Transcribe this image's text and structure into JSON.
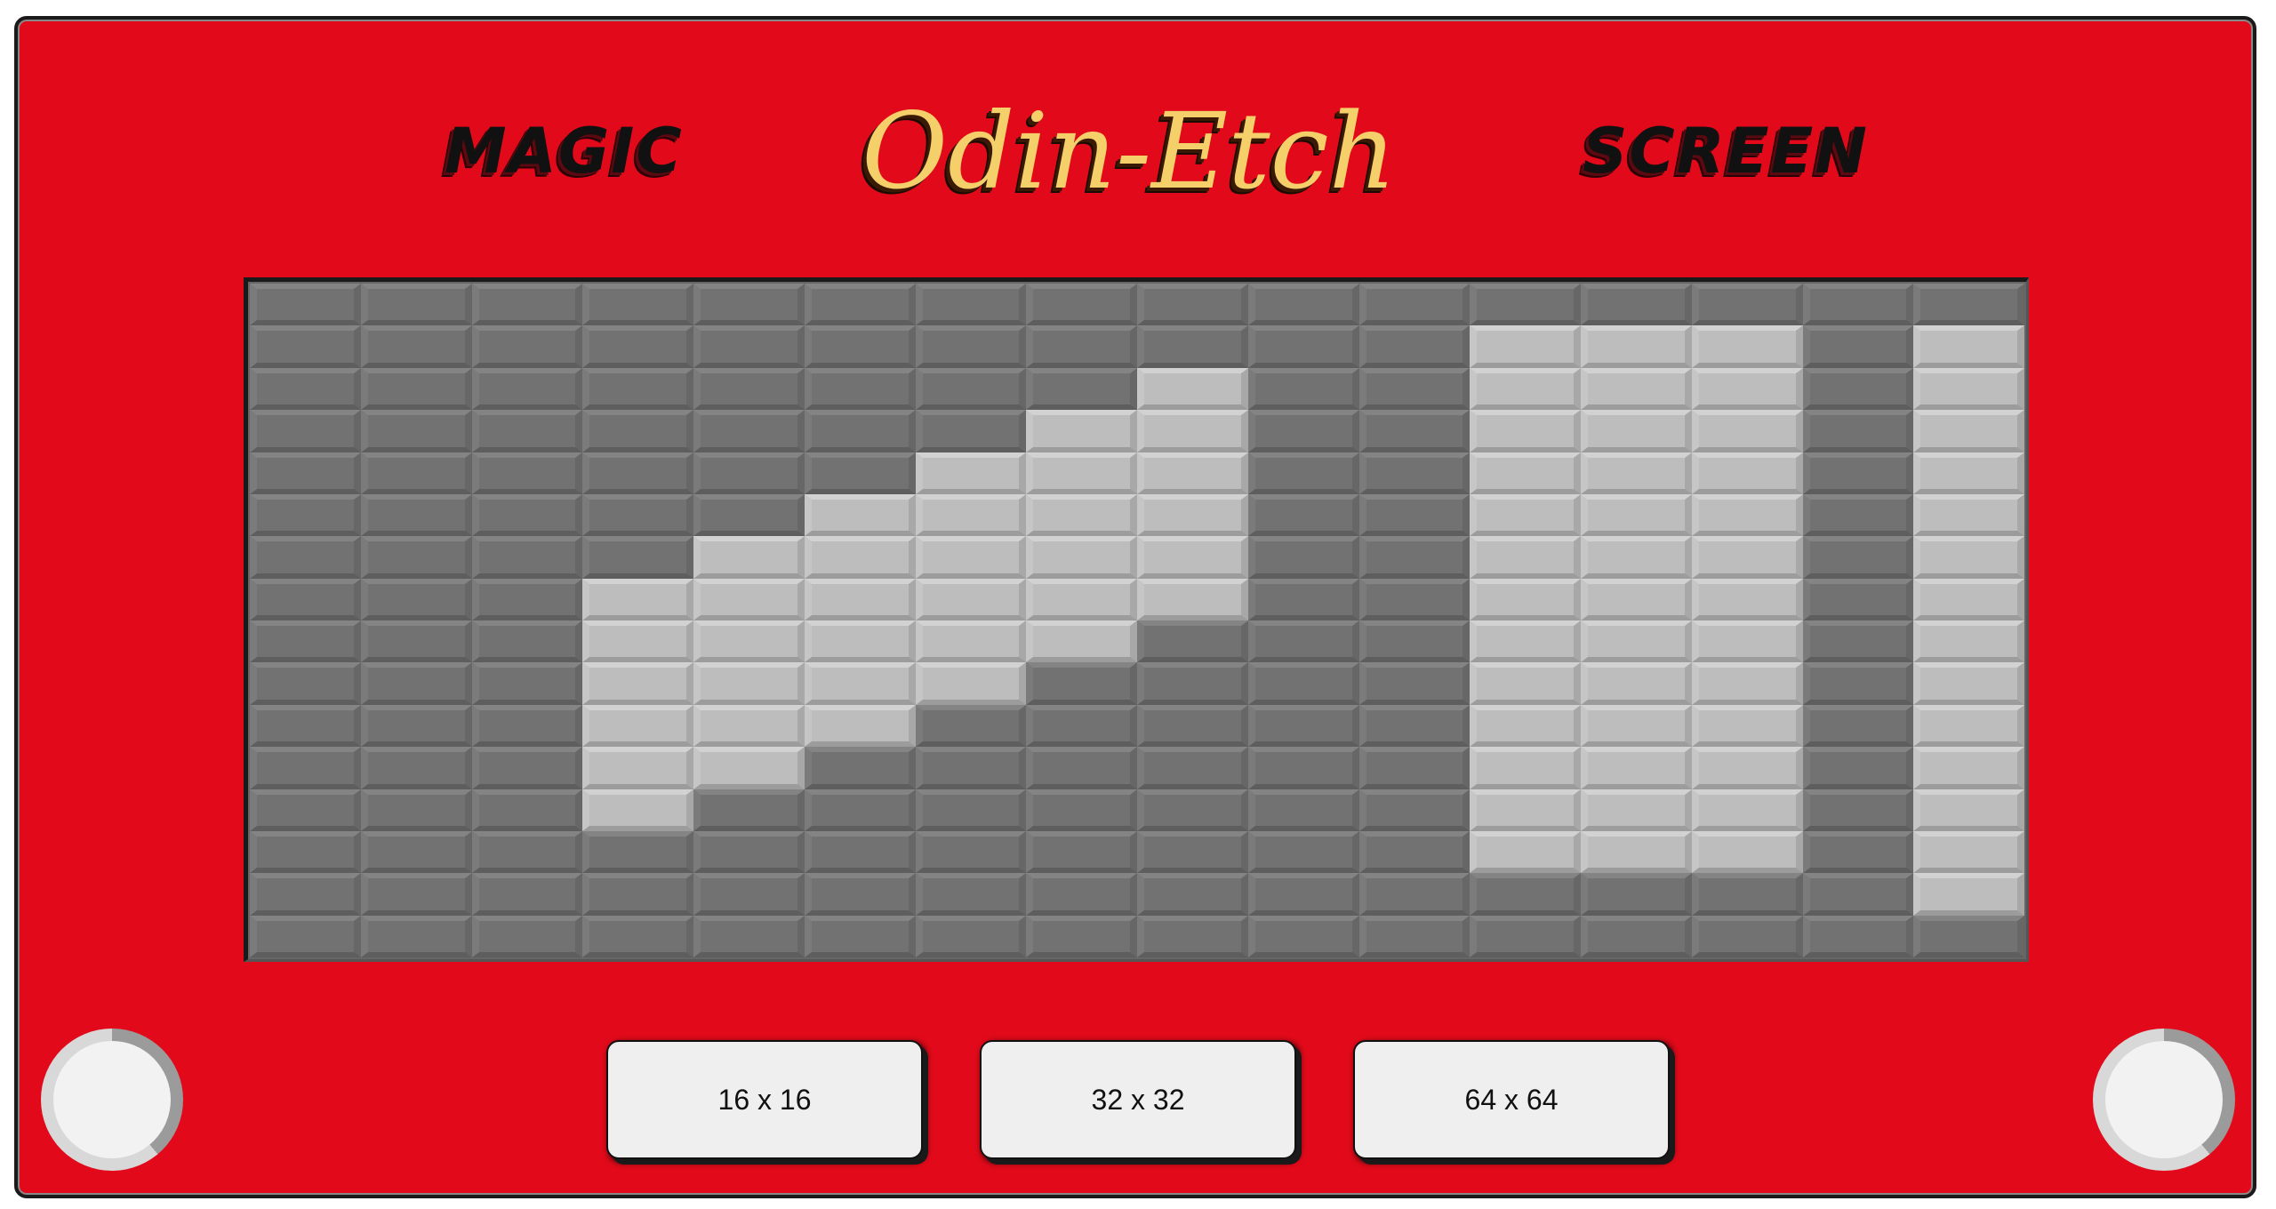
{
  "header": {
    "left_word": "MAGIC",
    "title": "Odin-Etch",
    "right_word": "SCREEN"
  },
  "grid": {
    "size": 16,
    "filled": [
      [
        1,
        11
      ],
      [
        1,
        12
      ],
      [
        1,
        13
      ],
      [
        1,
        15
      ],
      [
        2,
        8
      ],
      [
        2,
        11
      ],
      [
        2,
        12
      ],
      [
        2,
        13
      ],
      [
        2,
        15
      ],
      [
        3,
        7
      ],
      [
        3,
        8
      ],
      [
        3,
        11
      ],
      [
        3,
        12
      ],
      [
        3,
        13
      ],
      [
        3,
        15
      ],
      [
        4,
        6
      ],
      [
        4,
        7
      ],
      [
        4,
        8
      ],
      [
        4,
        11
      ],
      [
        4,
        12
      ],
      [
        4,
        13
      ],
      [
        4,
        15
      ],
      [
        5,
        5
      ],
      [
        5,
        6
      ],
      [
        5,
        7
      ],
      [
        5,
        8
      ],
      [
        5,
        11
      ],
      [
        5,
        12
      ],
      [
        5,
        13
      ],
      [
        5,
        15
      ],
      [
        6,
        4
      ],
      [
        6,
        5
      ],
      [
        6,
        6
      ],
      [
        6,
        7
      ],
      [
        6,
        8
      ],
      [
        6,
        11
      ],
      [
        6,
        12
      ],
      [
        6,
        13
      ],
      [
        6,
        15
      ],
      [
        7,
        3
      ],
      [
        7,
        4
      ],
      [
        7,
        5
      ],
      [
        7,
        6
      ],
      [
        7,
        7
      ],
      [
        7,
        8
      ],
      [
        7,
        11
      ],
      [
        7,
        12
      ],
      [
        7,
        13
      ],
      [
        7,
        15
      ],
      [
        8,
        3
      ],
      [
        8,
        4
      ],
      [
        8,
        5
      ],
      [
        8,
        6
      ],
      [
        8,
        7
      ],
      [
        8,
        11
      ],
      [
        8,
        12
      ],
      [
        8,
        13
      ],
      [
        8,
        15
      ],
      [
        9,
        3
      ],
      [
        9,
        4
      ],
      [
        9,
        5
      ],
      [
        9,
        6
      ],
      [
        9,
        11
      ],
      [
        9,
        12
      ],
      [
        9,
        13
      ],
      [
        9,
        15
      ],
      [
        10,
        3
      ],
      [
        10,
        4
      ],
      [
        10,
        5
      ],
      [
        10,
        11
      ],
      [
        10,
        12
      ],
      [
        10,
        13
      ],
      [
        10,
        15
      ],
      [
        11,
        3
      ],
      [
        11,
        4
      ],
      [
        11,
        11
      ],
      [
        11,
        12
      ],
      [
        11,
        13
      ],
      [
        11,
        15
      ],
      [
        12,
        3
      ],
      [
        12,
        11
      ],
      [
        12,
        12
      ],
      [
        12,
        13
      ],
      [
        12,
        15
      ],
      [
        13,
        11
      ],
      [
        13,
        12
      ],
      [
        13,
        13
      ],
      [
        13,
        15
      ],
      [
        14,
        15
      ]
    ]
  },
  "controls": {
    "buttons": [
      {
        "label": "16 x 16"
      },
      {
        "label": "32 x 32"
      },
      {
        "label": "64 x 64"
      }
    ]
  },
  "colors": {
    "body": "#e20a1a",
    "title": "#f5d06a",
    "cell_off": "#727272",
    "cell_on": "#bdbdbd"
  }
}
